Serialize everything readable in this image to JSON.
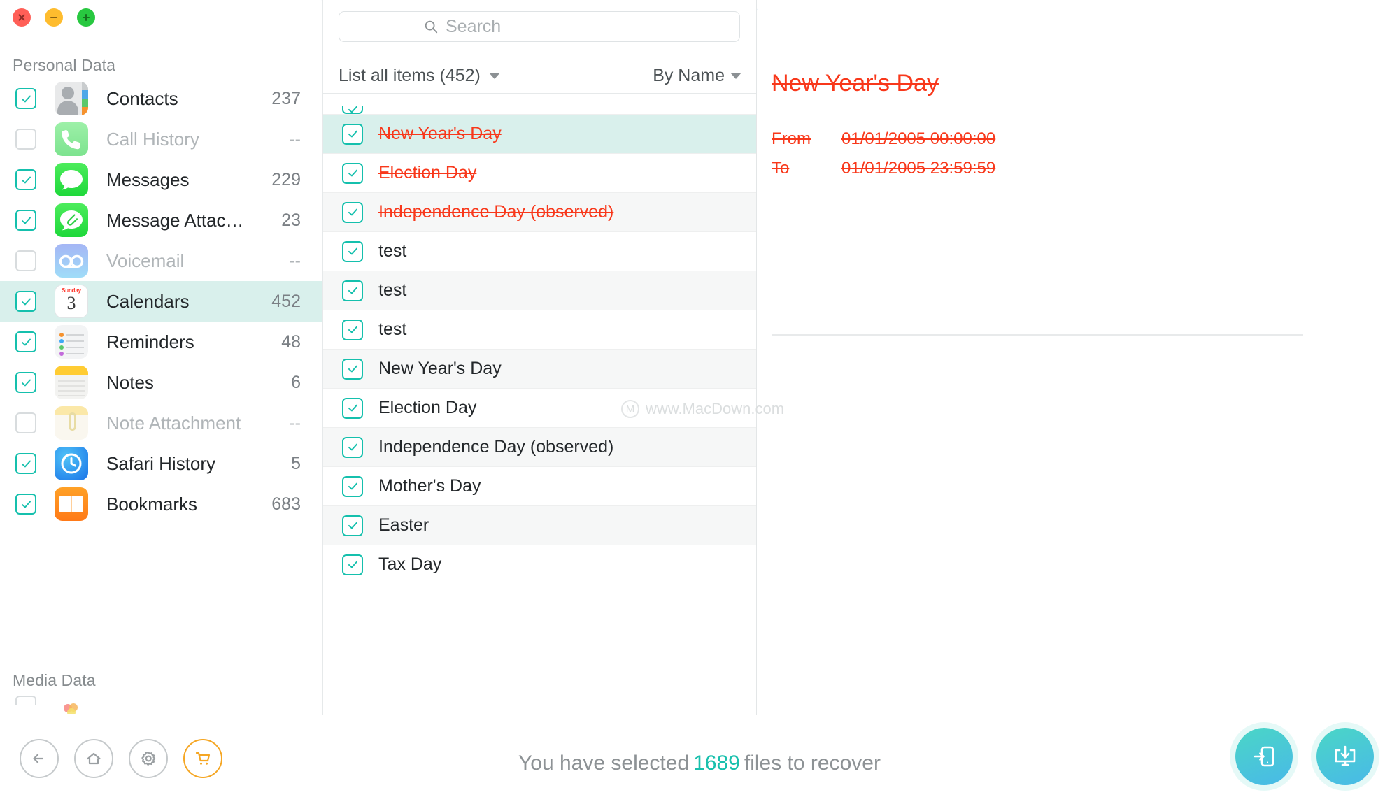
{
  "window": {
    "controls": [
      {
        "name": "close",
        "color": "#ff5f57"
      },
      {
        "name": "minimize",
        "color": "#febc2e"
      },
      {
        "name": "maximize",
        "color": "#28c840"
      }
    ]
  },
  "theme": {
    "accent_teal": "#19c0ad",
    "selected_row": "#d9f0ec",
    "deleted_red": "#f8381b",
    "cart_orange": "#f5a623",
    "button_gradient_from": "#4ad6c6",
    "button_gradient_to": "#49b9e8"
  },
  "sidebar": {
    "groups": [
      {
        "title": "Personal Data"
      },
      {
        "title": "Media Data"
      }
    ],
    "items": [
      {
        "label": "Contacts",
        "count": "237",
        "checked": true,
        "enabled": true,
        "selected": false,
        "icon": "contacts-icon"
      },
      {
        "label": "Call History",
        "count": "--",
        "checked": false,
        "enabled": false,
        "selected": false,
        "icon": "phone-icon"
      },
      {
        "label": "Messages",
        "count": "229",
        "checked": true,
        "enabled": true,
        "selected": false,
        "icon": "messages-icon"
      },
      {
        "label": "Message Attac…",
        "count": "23",
        "checked": true,
        "enabled": true,
        "selected": false,
        "icon": "message-attachment-icon"
      },
      {
        "label": "Voicemail",
        "count": "--",
        "checked": false,
        "enabled": false,
        "selected": false,
        "icon": "voicemail-icon"
      },
      {
        "label": "Calendars",
        "count": "452",
        "checked": true,
        "enabled": true,
        "selected": true,
        "icon": "calendar-icon"
      },
      {
        "label": "Reminders",
        "count": "48",
        "checked": true,
        "enabled": true,
        "selected": false,
        "icon": "reminders-icon"
      },
      {
        "label": "Notes",
        "count": "6",
        "checked": true,
        "enabled": true,
        "selected": false,
        "icon": "notes-icon"
      },
      {
        "label": "Note Attachment",
        "count": "--",
        "checked": false,
        "enabled": false,
        "selected": false,
        "icon": "note-attachment-icon"
      },
      {
        "label": "Safari History",
        "count": "5",
        "checked": true,
        "enabled": true,
        "selected": false,
        "icon": "safari-icon"
      },
      {
        "label": "Bookmarks",
        "count": "683",
        "checked": true,
        "enabled": true,
        "selected": false,
        "icon": "bookmarks-icon"
      }
    ],
    "calendar_icon": {
      "weekday": "Sunday",
      "day": "3"
    }
  },
  "search": {
    "value": "",
    "placeholder": "Search"
  },
  "filter": {
    "list_label": "List all items (452)",
    "sort_label": "By Name"
  },
  "list": {
    "items": [
      {
        "label": "",
        "checked": true,
        "deleted": true,
        "selected": false,
        "partial": true
      },
      {
        "label": "New Year's Day",
        "checked": true,
        "deleted": true,
        "selected": true,
        "partial": false
      },
      {
        "label": "Election Day",
        "checked": true,
        "deleted": true,
        "selected": false,
        "partial": false
      },
      {
        "label": "Independence Day (observed)",
        "checked": true,
        "deleted": true,
        "selected": false,
        "partial": false
      },
      {
        "label": "test",
        "checked": true,
        "deleted": false,
        "selected": false,
        "partial": false
      },
      {
        "label": "test",
        "checked": true,
        "deleted": false,
        "selected": false,
        "partial": false
      },
      {
        "label": "test",
        "checked": true,
        "deleted": false,
        "selected": false,
        "partial": false
      },
      {
        "label": "New Year's Day",
        "checked": true,
        "deleted": false,
        "selected": false,
        "partial": false
      },
      {
        "label": "Election Day",
        "checked": true,
        "deleted": false,
        "selected": false,
        "partial": false
      },
      {
        "label": "Independence Day (observed)",
        "checked": true,
        "deleted": false,
        "selected": false,
        "partial": false
      },
      {
        "label": "Mother's Day",
        "checked": true,
        "deleted": false,
        "selected": false,
        "partial": false
      },
      {
        "label": "Easter",
        "checked": true,
        "deleted": false,
        "selected": false,
        "partial": false
      },
      {
        "label": "Tax Day",
        "checked": true,
        "deleted": false,
        "selected": false,
        "partial": false
      }
    ]
  },
  "detail": {
    "title": "New Year's Day",
    "fields": [
      {
        "key": "From",
        "value": "01/01/2005 00:00:00"
      },
      {
        "key": "To",
        "value": "01/01/2005 23:59:59"
      }
    ]
  },
  "watermark": {
    "text": "www.MacDown.com",
    "logo_letter": "M"
  },
  "bottom": {
    "buttons": [
      {
        "name": "back-button",
        "icon": "arrow-left-icon"
      },
      {
        "name": "home-button",
        "icon": "home-icon"
      },
      {
        "name": "settings-button",
        "icon": "gear-icon"
      },
      {
        "name": "cart-button",
        "icon": "shopping-cart-icon"
      }
    ],
    "status_prefix": "You have selected",
    "status_count": "1689",
    "status_suffix": "files to recover",
    "recover_device_icon": "recover-to-device-icon",
    "recover_computer_icon": "recover-to-computer-icon"
  }
}
